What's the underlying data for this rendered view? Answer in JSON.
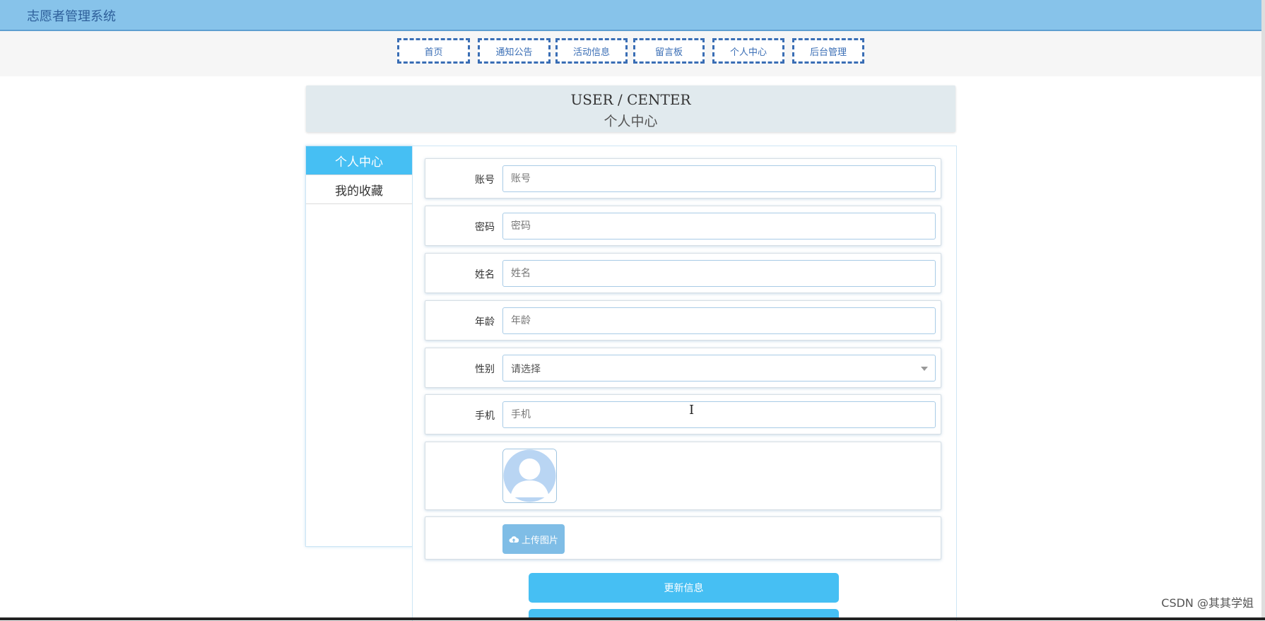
{
  "app": {
    "title": "志愿者管理系统"
  },
  "nav": {
    "items": [
      "首页",
      "通知公告",
      "活动信息",
      "留言板",
      "个人中心",
      "后台管理"
    ]
  },
  "banner": {
    "en": "USER / CENTER",
    "cn": "个人中心"
  },
  "sidebar": {
    "items": [
      {
        "label": "个人中心",
        "active": true
      },
      {
        "label": "我的收藏",
        "active": false
      }
    ]
  },
  "form": {
    "account": {
      "label": "账号",
      "placeholder": "账号",
      "value": ""
    },
    "password": {
      "label": "密码",
      "placeholder": "密码",
      "value": ""
    },
    "name": {
      "label": "姓名",
      "placeholder": "姓名",
      "value": ""
    },
    "age": {
      "label": "年龄",
      "placeholder": "年龄",
      "value": ""
    },
    "gender": {
      "label": "性别",
      "selected": "请选择"
    },
    "phone": {
      "label": "手机",
      "placeholder": "手机",
      "value": ""
    },
    "upload_label": "上传图片",
    "update_label": "更新信息"
  },
  "icons": {
    "upload": "cloud-upload-icon",
    "avatar": "user-avatar-icon",
    "caret": "chevron-down-icon"
  },
  "colors": {
    "topbar": "#87c3ea",
    "accent": "#46bff3",
    "nav_border": "#3a6eb5"
  },
  "watermark": "CSDN @其其学姐"
}
